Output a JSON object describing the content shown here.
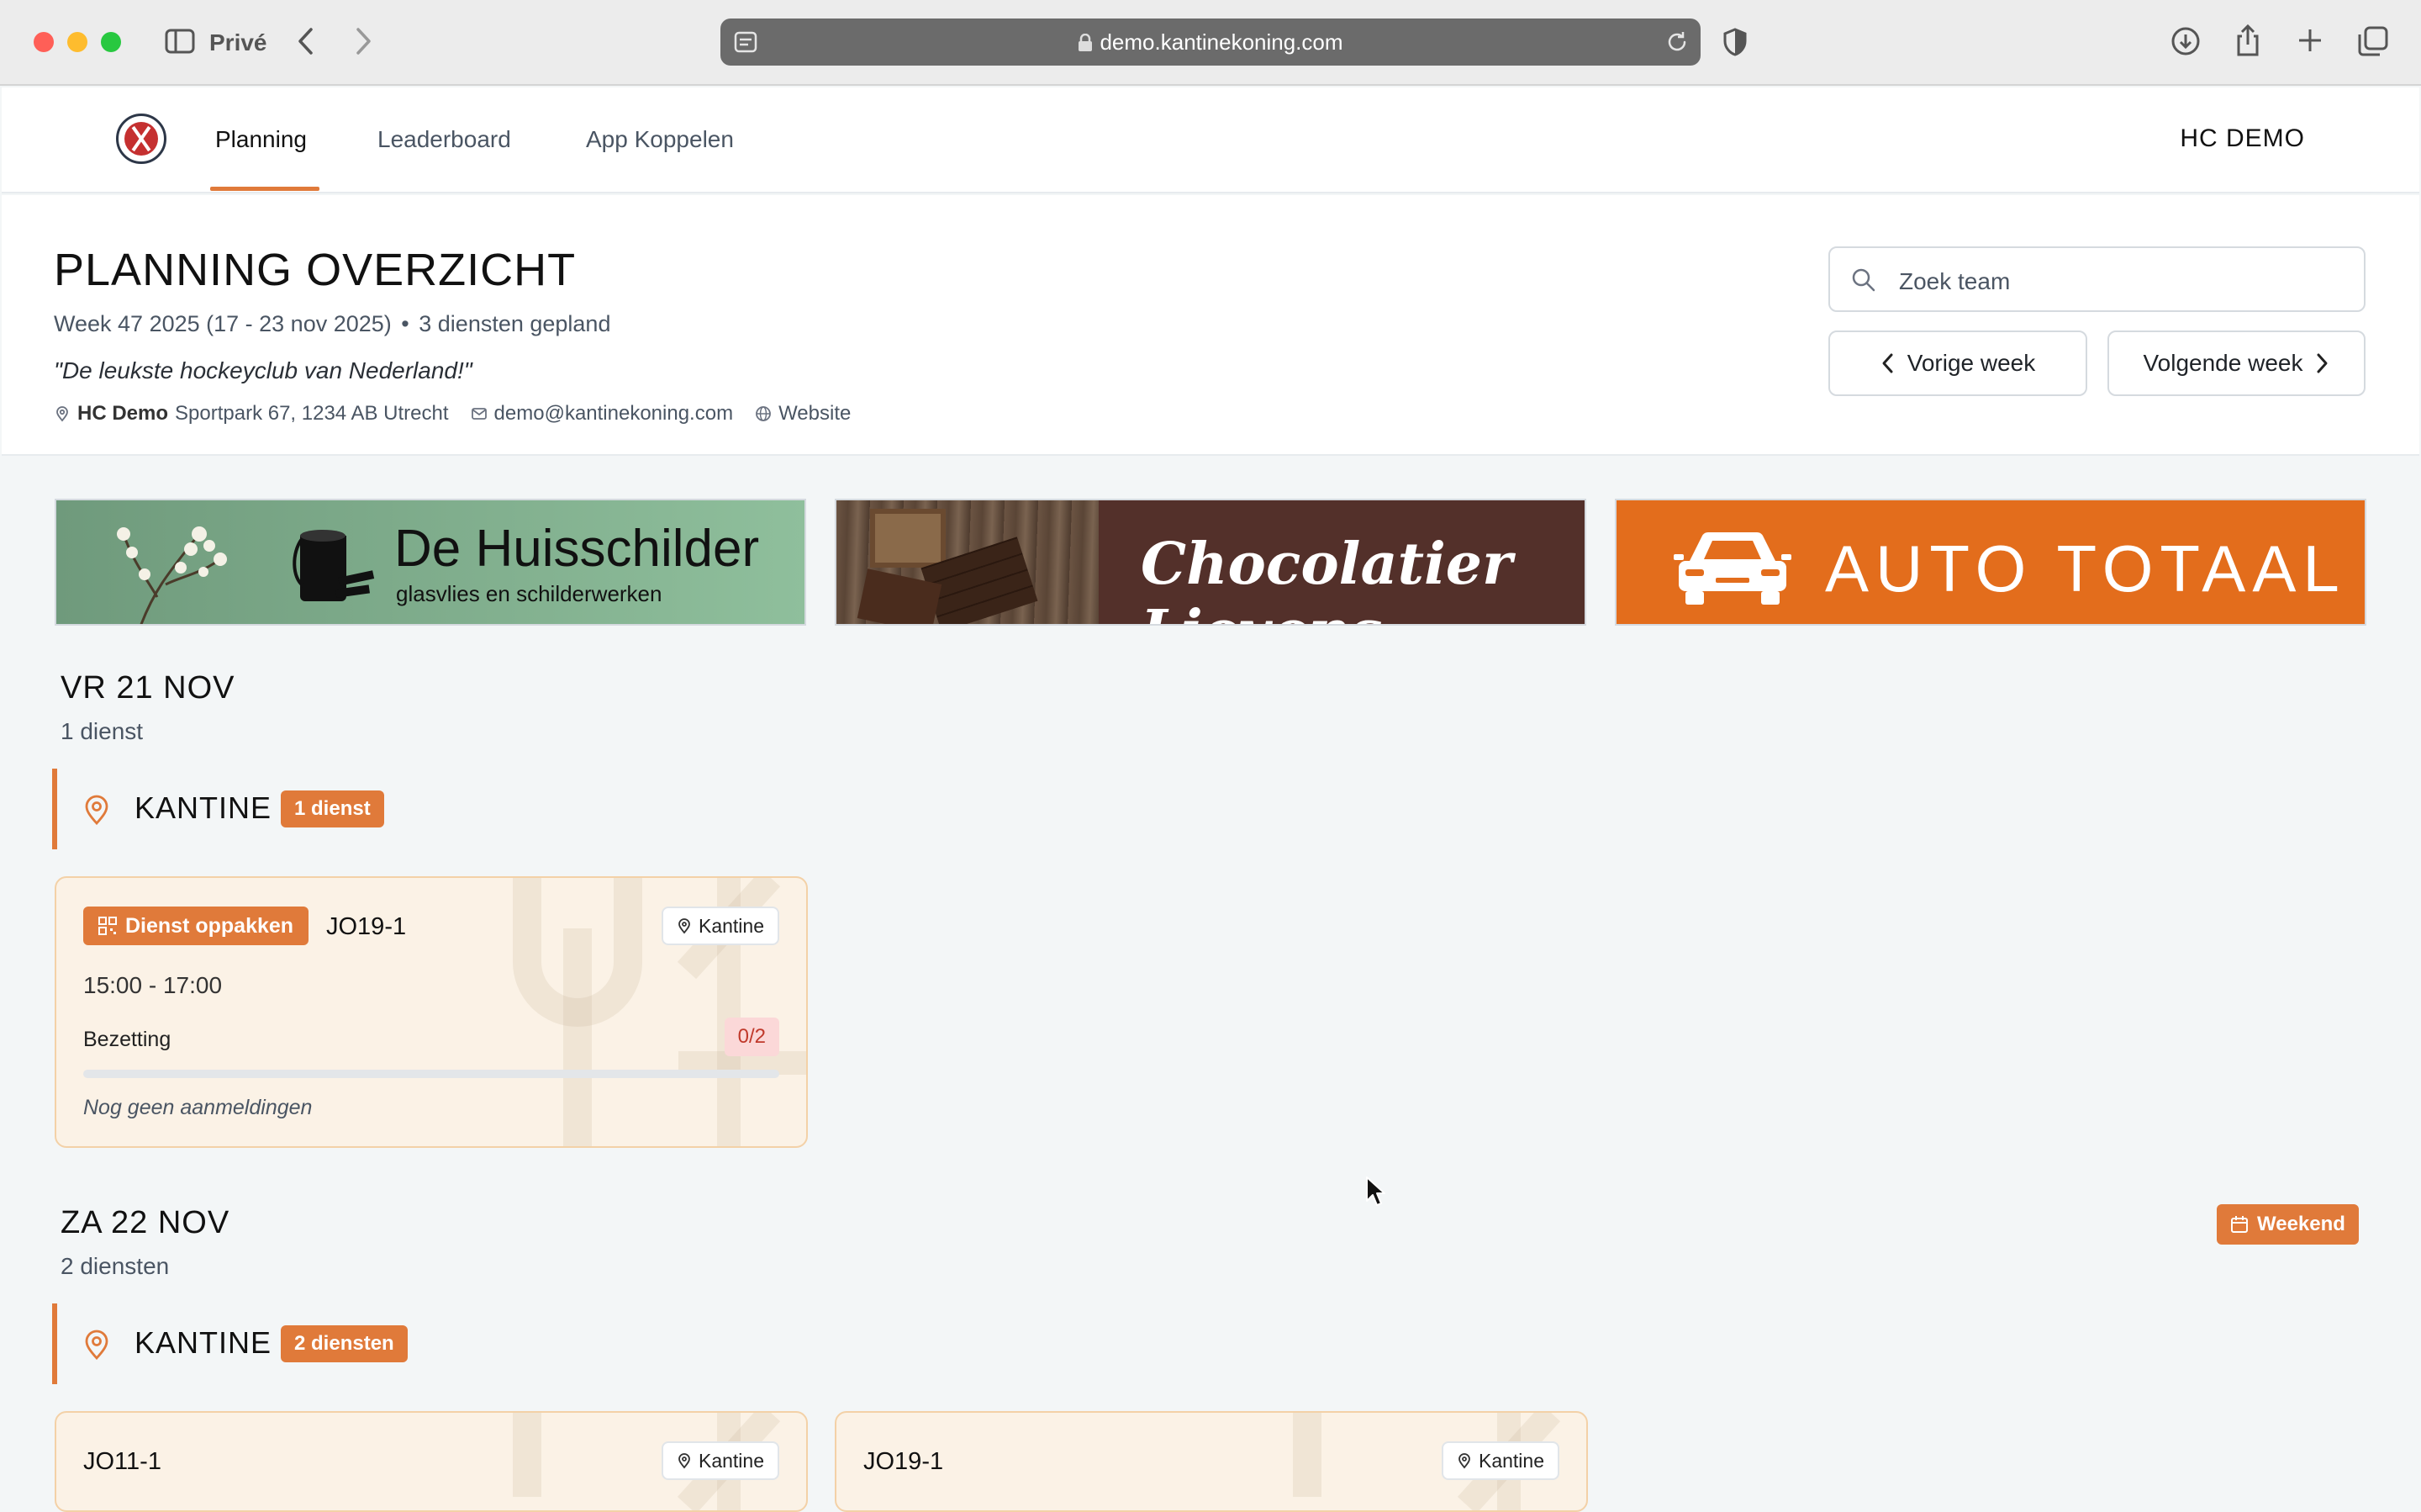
{
  "browser": {
    "mode_label": "Privé",
    "url": "demo.kantinekoning.com"
  },
  "nav": {
    "tabs": [
      {
        "label": "Planning",
        "active": true
      },
      {
        "label": "Leaderboard",
        "active": false
      },
      {
        "label": "App Koppelen",
        "active": false
      }
    ],
    "club": "HC DEMO"
  },
  "header": {
    "title": "PLANNING OVERZICHT",
    "week": "Week 47 2025 (17 - 23 nov 2025)",
    "separator": "•",
    "count": "3 diensten gepland",
    "quote": "\"De leukste hockeyclub van Nederland!\"",
    "club_bold": "HC Demo",
    "address": "Sportpark 67, 1234 AB Utrecht",
    "email": "demo@kantinekoning.com",
    "website": "Website",
    "search_placeholder": "Zoek team",
    "prev_week": "Vorige week",
    "next_week": "Volgende week"
  },
  "sponsors": [
    {
      "name": "De Huisschilder",
      "tagline": "glasvlies en schilderwerken"
    },
    {
      "name": "Chocolatier Lievens"
    },
    {
      "name": "AUTO TOTAAL"
    }
  ],
  "days": [
    {
      "title": "VR 21 NOV",
      "sub": "1 dienst",
      "location": "KANTINE",
      "location_badge": "1 dienst",
      "cards": [
        {
          "pickup": "Dienst oppakken",
          "team": "JO19-1",
          "location": "Kantine",
          "time": "15:00 - 17:00",
          "occupancy_label": "Bezetting",
          "occupancy": "0/2",
          "fill_fraction": 0,
          "empty_note": "Nog geen aanmeldingen"
        }
      ]
    },
    {
      "title": "ZA 22 NOV",
      "sub": "2 diensten",
      "weekend_badge": "Weekend",
      "location": "KANTINE",
      "location_badge": "2 diensten",
      "cards": [
        {
          "team": "JO11-1",
          "location": "Kantine"
        },
        {
          "team": "JO19-1",
          "location": "Kantine"
        }
      ]
    }
  ],
  "colors": {
    "accent": "#e07a3a",
    "danger_bg": "#fbd8d8",
    "danger_text": "#c0392b",
    "card_bg": "#fbf2e6"
  }
}
